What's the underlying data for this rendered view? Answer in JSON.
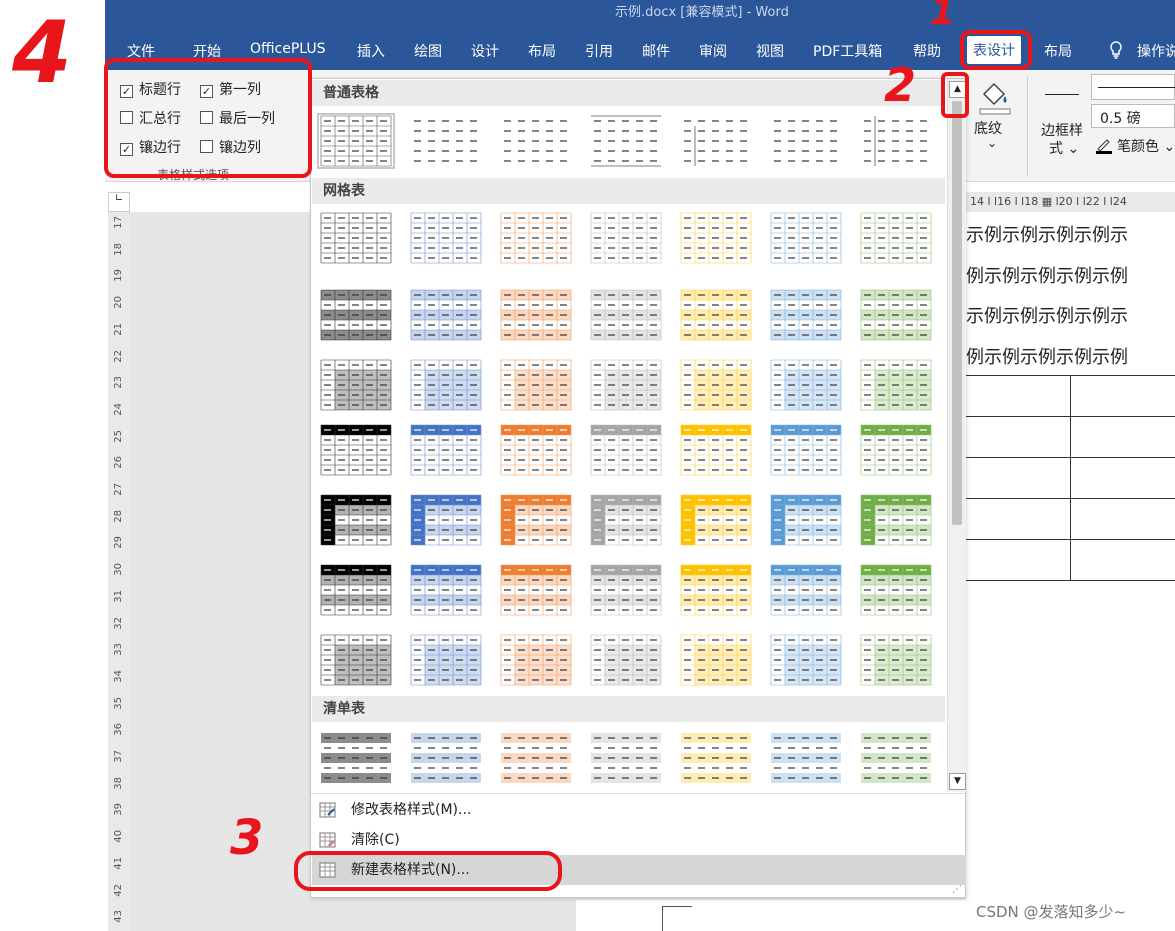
{
  "window": {
    "title": "示例.docx [兼容模式] - Word"
  },
  "tabs": [
    {
      "label": "文件"
    },
    {
      "label": "开始"
    },
    {
      "label": "OfficePLUS"
    },
    {
      "label": "插入"
    },
    {
      "label": "绘图"
    },
    {
      "label": "设计"
    },
    {
      "label": "布局"
    },
    {
      "label": "引用"
    },
    {
      "label": "邮件"
    },
    {
      "label": "审阅"
    },
    {
      "label": "视图"
    },
    {
      "label": "PDF工具箱"
    },
    {
      "label": "帮助"
    },
    {
      "label": "表设计"
    },
    {
      "label": "布局"
    },
    {
      "label": "操作说明搜索"
    }
  ],
  "active_tab": "表设计",
  "style_options": {
    "group_label": "表格样式选项",
    "items": [
      {
        "label": "标题行",
        "checked": true,
        "check": "✓"
      },
      {
        "label": "第一列",
        "checked": true,
        "check": "✓"
      },
      {
        "label": "汇总行",
        "checked": false,
        "check": ""
      },
      {
        "label": "最后一列",
        "checked": false,
        "check": ""
      },
      {
        "label": "镶边行",
        "checked": true,
        "check": "✓"
      },
      {
        "label": "镶边列",
        "checked": false,
        "check": ""
      }
    ]
  },
  "right_ribbon": {
    "shading": "底纹",
    "shading_arrow": "⌄",
    "border_style": "边框样式",
    "border_style_line1": "边框样",
    "border_style_line2": "式 ⌄",
    "pen_weight": "0.5 磅",
    "pen_color": "笔颜色 ⌄"
  },
  "gallery": {
    "sections": [
      {
        "title": "普通表格",
        "kind": "plain"
      },
      {
        "title": "网格表",
        "kind": "grid"
      },
      {
        "title": "清单表",
        "kind": "list"
      }
    ],
    "accent_colors": [
      "#000000",
      "#4472c4",
      "#ed7d31",
      "#a5a5a5",
      "#ffc000",
      "#5b9bd5",
      "#70ad47"
    ],
    "scroll_up": "▲",
    "scroll_down": "▼",
    "menu": [
      {
        "label": "修改表格样式(M)..."
      },
      {
        "label": "清除(C)"
      },
      {
        "label": "新建表格样式(N)..."
      }
    ]
  },
  "ruler": {
    "top_text": "14 l   l16 l   l18 ▦ l20 l   l22 l   l24",
    "vertical": [
      "17",
      "18",
      "19",
      "20",
      "21",
      "22",
      "23",
      "24",
      "25",
      "26",
      "27",
      "28",
      "29",
      "30",
      "31",
      "32",
      "33",
      "34",
      "35",
      "36",
      "37",
      "38",
      "39",
      "40",
      "41",
      "42",
      "43"
    ]
  },
  "document": {
    "lines": [
      "示例示例示例示例示",
      "例示例示例示例示例",
      "示例示例示例示例示",
      "例示例示例示例示例"
    ],
    "table_rows": 5
  },
  "annotations": [
    "1",
    "2",
    "3",
    "4"
  ],
  "watermark": "CSDN @发落知多少~"
}
